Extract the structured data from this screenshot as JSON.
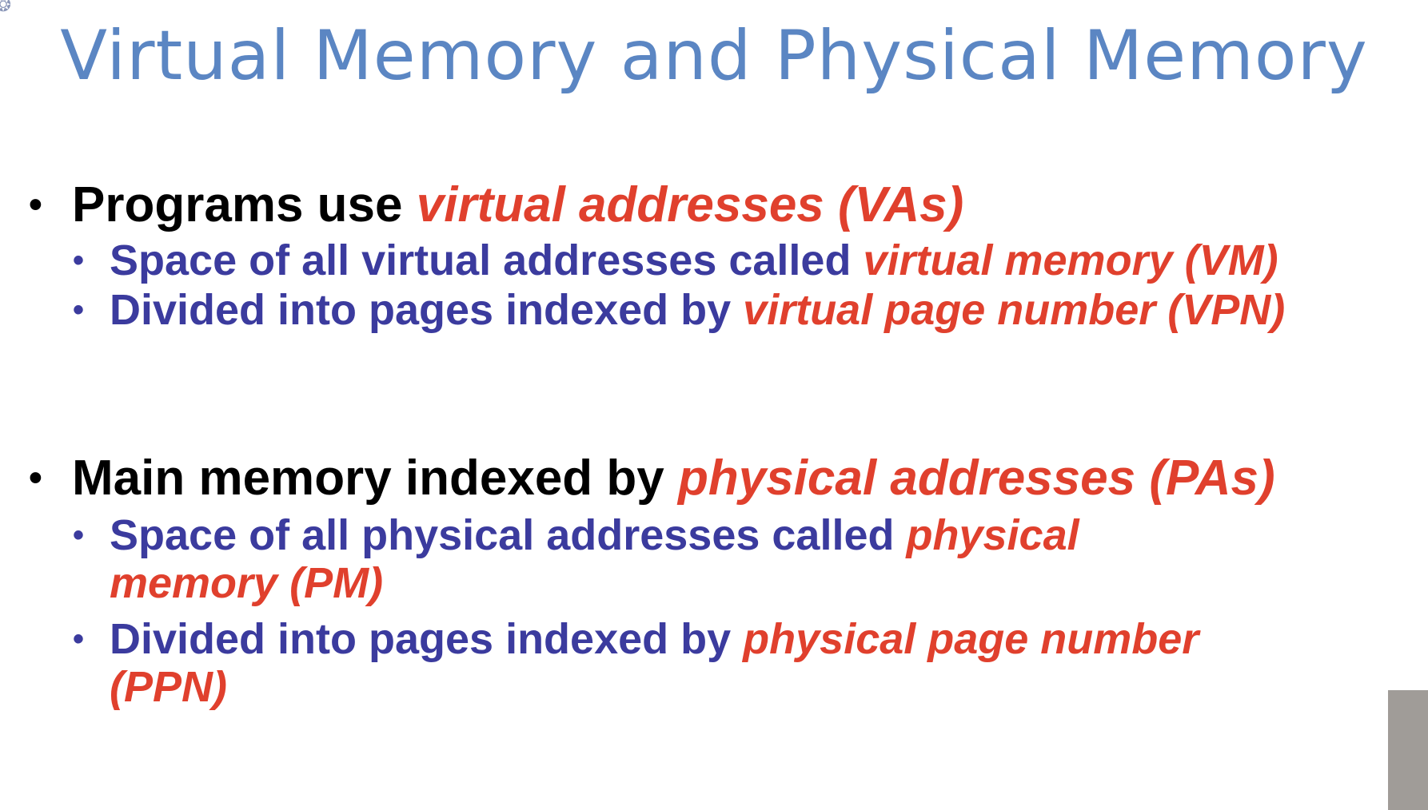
{
  "slide": {
    "title": "Virtual Memory and Physical Memory",
    "bullets": [
      {
        "text": "Programs use ",
        "emphasis": "virtual addresses (VAs)",
        "sub": [
          {
            "text": "Space of all virtual addresses called ",
            "emphasis": "virtual memory (VM)"
          },
          {
            "text": "Divided into pages indexed by ",
            "emphasis": "virtual page number (VPN)"
          }
        ]
      },
      {
        "text": "Main memory indexed by ",
        "emphasis": "physical addresses (PAs)",
        "sub": [
          {
            "text": "Space of all physical addresses called ",
            "emphasis": "physical",
            "continuation": "memory (PM)"
          },
          {
            "text": "Divided into pages indexed by ",
            "emphasis": "physical page number",
            "continuation": "(PPN)"
          }
        ]
      }
    ]
  }
}
